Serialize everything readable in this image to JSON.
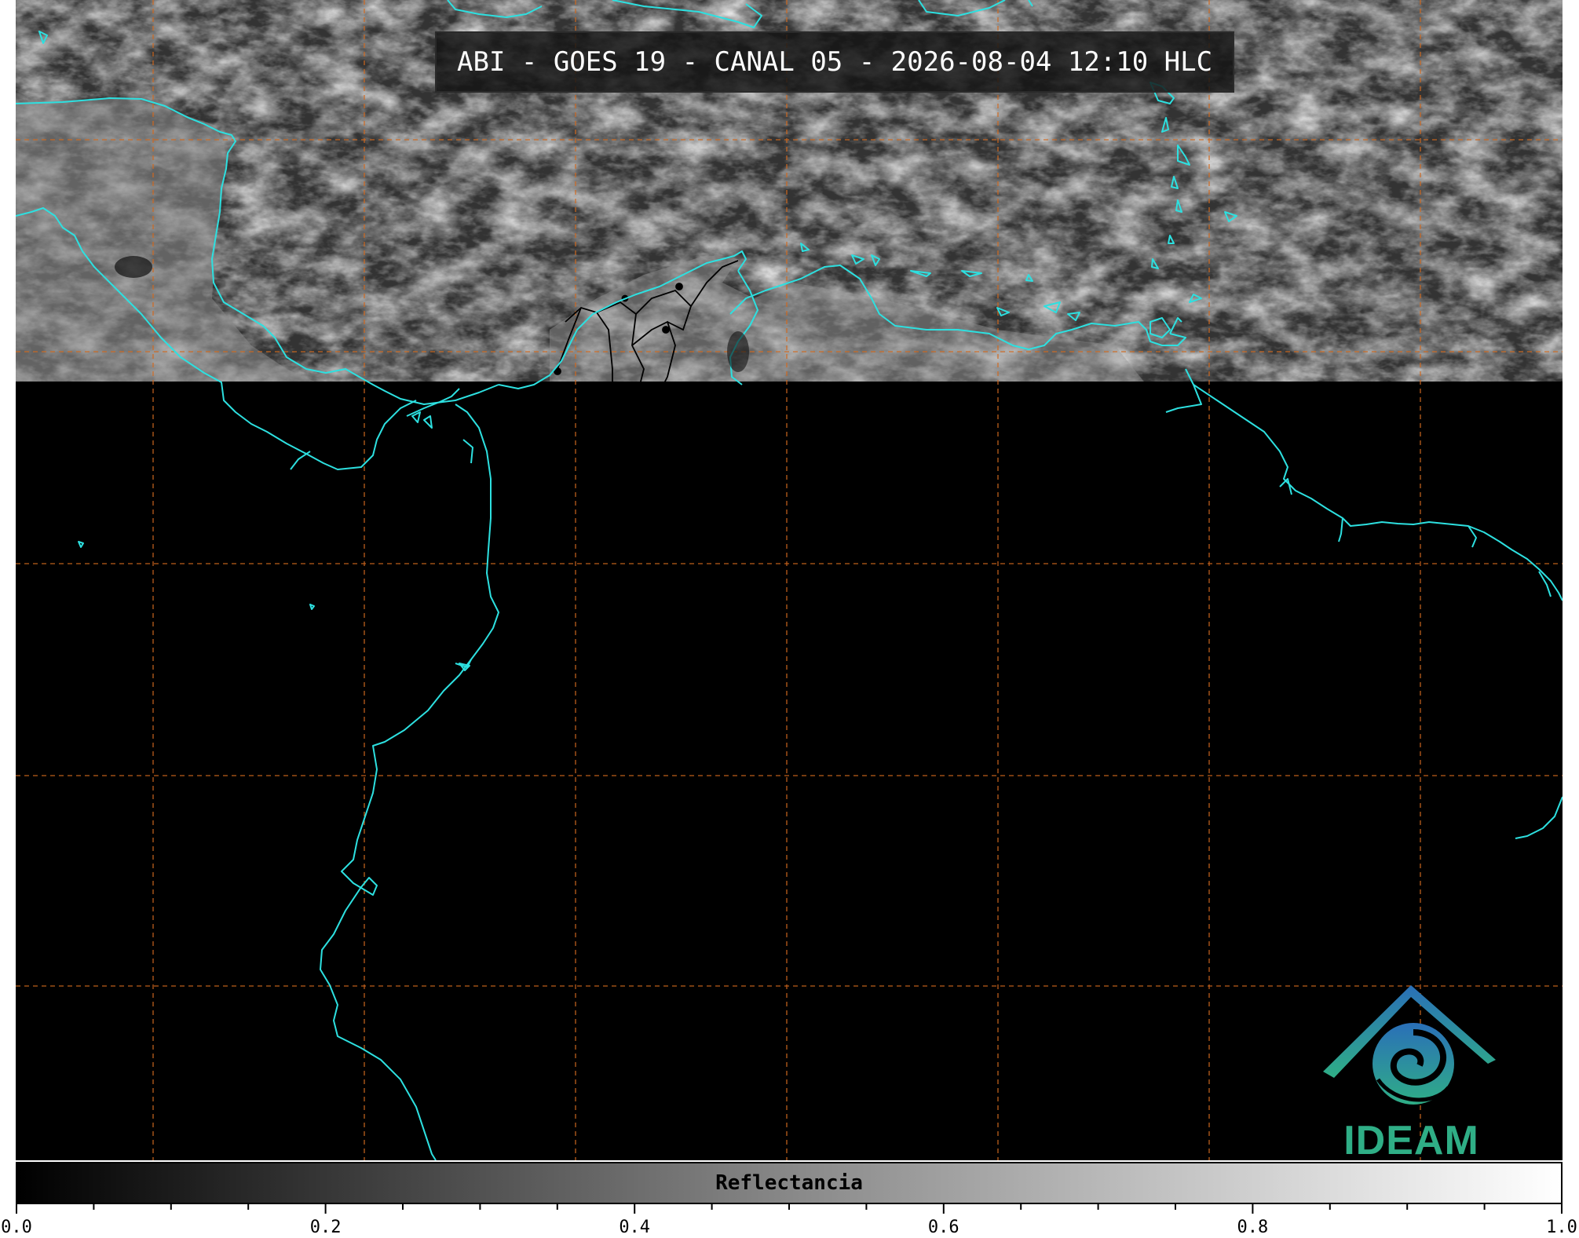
{
  "title": "ABI - GOES 19 - CANAL 05 - 2026-08-04 12:10 HLC",
  "logo": {
    "name": "IDEAM",
    "text": "IDEAM"
  },
  "colorbar": {
    "label": "Reflectancia",
    "min": 0.0,
    "max": 1.0,
    "colormap": "gray",
    "tick_labels": [
      "0.0",
      "0.2",
      "0.4",
      "0.6",
      "0.8",
      "1.0"
    ],
    "major_ticks": [
      0.0,
      0.2,
      0.4,
      0.6,
      0.8,
      1.0
    ],
    "minor_step": 0.05
  },
  "map": {
    "coastline_color": "#2de0e0",
    "gridline_color": "#d2691e",
    "gridline_style": "dashed",
    "internal_borders_color": "#000000",
    "background_color": "#000000",
    "imagery": "visible reflectance clouds over northern part of domain"
  }
}
